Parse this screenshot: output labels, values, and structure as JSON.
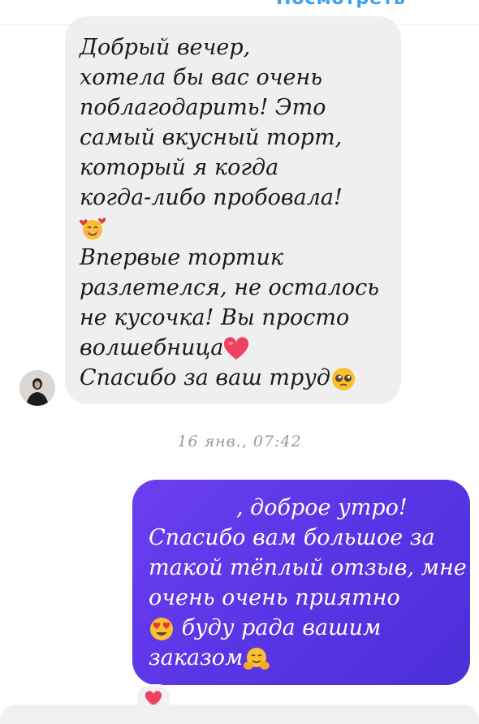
{
  "header": {
    "partial_link": "Посмотреть"
  },
  "incoming": {
    "lines": [
      "Добрый вечер,",
      "хотела бы вас очень",
      "поблагодарить! Это",
      "самый вкусный торт,",
      "который я когда",
      "когда-либо пробовала!",
      "",
      "Впервые тортик",
      "разлетелся, не осталось",
      "не кусочка! Вы просто",
      "волшебница",
      "Спасибо за ваш труд"
    ],
    "emoji": [
      "smiling-face-with-hearts",
      "red-heart",
      "pleading-face"
    ]
  },
  "timestamp": "16 янв., 07:42",
  "outgoing": {
    "lines": [
      ", доброе утро!",
      "Спасибо вам большое за",
      "такой тёплый отзыв, мне",
      "очень очень приятно",
      "буду рада вашим",
      "заказом"
    ],
    "emoji": [
      "heart-eyes-face",
      "hugging-face"
    ]
  },
  "reaction": {
    "emoji": "red-heart"
  },
  "colors": {
    "incoming_bubble": "#efefef",
    "outgoing_bubble": "#5a35e6",
    "timestamp": "#9a9a9a",
    "link": "#3aa0f0"
  }
}
